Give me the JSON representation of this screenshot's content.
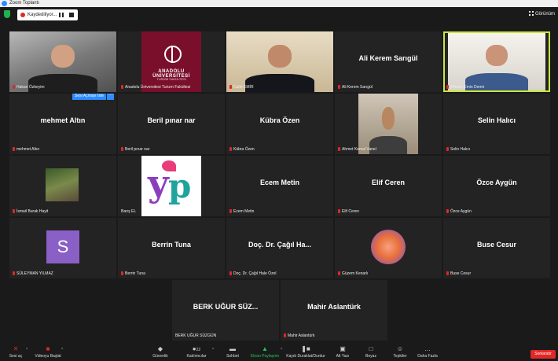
{
  "window": {
    "title": "Zoom Toplantı"
  },
  "recording": {
    "status": "Kaydediliyor..."
  },
  "view": {
    "label": "Görünüm"
  },
  "tiles": [
    {
      "label": "Hakan Özbeyim",
      "kind": "video"
    },
    {
      "label": "Anadolu Üniversitesi Turizm Fakültesi",
      "kind": "logo",
      "logo_line1": "ANADOLU ÜNİVERSİTESİ",
      "logo_line2": "TURİZM FAKÜLTESİ"
    },
    {
      "label": "Cahit EMİR",
      "kind": "video"
    },
    {
      "name": "Ali Kerem Sarıgül",
      "label": "Ali Kerem Sarıgül",
      "kind": "name"
    },
    {
      "label": "iPhone-Emin Demir",
      "kind": "video",
      "active": true
    },
    {
      "name": "mehmet Altın",
      "label": "mehmet Altın",
      "kind": "name"
    },
    {
      "name": "Beril pınar nar",
      "label": "Beril pınar nar",
      "kind": "name"
    },
    {
      "name": "Kübra Özen",
      "label": "Kübra Özen",
      "kind": "name"
    },
    {
      "label": "Ahmet Kemal Vanel",
      "kind": "video"
    },
    {
      "name": "Selin Halıcı",
      "label": "Selin Halıcı",
      "kind": "name"
    },
    {
      "label": "İsmail Burak Hayit",
      "kind": "photo"
    },
    {
      "label": "Barış EL",
      "kind": "logo2"
    },
    {
      "name": "Ecem Metin",
      "label": "Ecem Metin",
      "kind": "name"
    },
    {
      "name": "Elif Ceren",
      "label": "Elif Ceren",
      "kind": "name"
    },
    {
      "name": "Özce Aygün",
      "label": "Özce Aygün",
      "kind": "name"
    },
    {
      "label": "SÜLEYMAN YILMAZ",
      "kind": "avatar",
      "initial": "S"
    },
    {
      "name": "Berrin Tuna",
      "label": "Berrin Tuna",
      "kind": "name"
    },
    {
      "name": "Doç. Dr. Çağıl Ha...",
      "label": "Doç. Dr. Çağıl Hale Özel",
      "kind": "name"
    },
    {
      "label": "Güzem Kenarlı",
      "kind": "orb"
    },
    {
      "name": "Buse Cesur",
      "label": "Buse Cesur",
      "kind": "name"
    },
    {
      "name": "BERK UĞUR SÜZ...",
      "label": "BERK UĞUR SÜZGÜN",
      "kind": "name"
    },
    {
      "name": "Mahir Aslantürk",
      "label": "Mahir Aslantürk",
      "kind": "name"
    }
  ],
  "hover_menu": {
    "unmute": "Sesi Açmayı İste",
    "more": "···"
  },
  "toolbar": {
    "mic": "Sesi aç",
    "video": "Videoyu Başlat",
    "security": "Güvenlik",
    "participants": "Katılımcılar",
    "participants_count": "22",
    "chat": "Sohbet",
    "share": "Ekran Paylaşımı",
    "pause_recording": "Kaydı Duraklat/Durdur",
    "captions": "Alt Yazı",
    "whiteboard": "Beyaz",
    "reactions": "Tepkiler",
    "more": "Daha Fazla",
    "end": "Sonlandır"
  }
}
